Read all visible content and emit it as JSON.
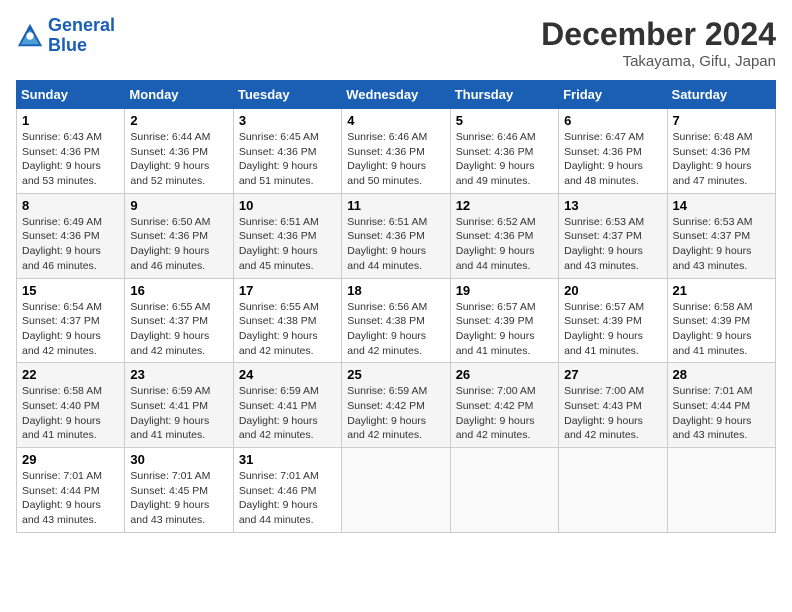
{
  "logo": {
    "line1": "General",
    "line2": "Blue"
  },
  "header": {
    "month": "December 2024",
    "location": "Takayama, Gifu, Japan"
  },
  "weekdays": [
    "Sunday",
    "Monday",
    "Tuesday",
    "Wednesday",
    "Thursday",
    "Friday",
    "Saturday"
  ],
  "weeks": [
    [
      {
        "day": "1",
        "sunrise": "6:43 AM",
        "sunset": "4:36 PM",
        "daylight": "9 hours and 53 minutes."
      },
      {
        "day": "2",
        "sunrise": "6:44 AM",
        "sunset": "4:36 PM",
        "daylight": "9 hours and 52 minutes."
      },
      {
        "day": "3",
        "sunrise": "6:45 AM",
        "sunset": "4:36 PM",
        "daylight": "9 hours and 51 minutes."
      },
      {
        "day": "4",
        "sunrise": "6:46 AM",
        "sunset": "4:36 PM",
        "daylight": "9 hours and 50 minutes."
      },
      {
        "day": "5",
        "sunrise": "6:46 AM",
        "sunset": "4:36 PM",
        "daylight": "9 hours and 49 minutes."
      },
      {
        "day": "6",
        "sunrise": "6:47 AM",
        "sunset": "4:36 PM",
        "daylight": "9 hours and 48 minutes."
      },
      {
        "day": "7",
        "sunrise": "6:48 AM",
        "sunset": "4:36 PM",
        "daylight": "9 hours and 47 minutes."
      }
    ],
    [
      {
        "day": "8",
        "sunrise": "6:49 AM",
        "sunset": "4:36 PM",
        "daylight": "9 hours and 46 minutes."
      },
      {
        "day": "9",
        "sunrise": "6:50 AM",
        "sunset": "4:36 PM",
        "daylight": "9 hours and 46 minutes."
      },
      {
        "day": "10",
        "sunrise": "6:51 AM",
        "sunset": "4:36 PM",
        "daylight": "9 hours and 45 minutes."
      },
      {
        "day": "11",
        "sunrise": "6:51 AM",
        "sunset": "4:36 PM",
        "daylight": "9 hours and 44 minutes."
      },
      {
        "day": "12",
        "sunrise": "6:52 AM",
        "sunset": "4:36 PM",
        "daylight": "9 hours and 44 minutes."
      },
      {
        "day": "13",
        "sunrise": "6:53 AM",
        "sunset": "4:37 PM",
        "daylight": "9 hours and 43 minutes."
      },
      {
        "day": "14",
        "sunrise": "6:53 AM",
        "sunset": "4:37 PM",
        "daylight": "9 hours and 43 minutes."
      }
    ],
    [
      {
        "day": "15",
        "sunrise": "6:54 AM",
        "sunset": "4:37 PM",
        "daylight": "9 hours and 42 minutes."
      },
      {
        "day": "16",
        "sunrise": "6:55 AM",
        "sunset": "4:37 PM",
        "daylight": "9 hours and 42 minutes."
      },
      {
        "day": "17",
        "sunrise": "6:55 AM",
        "sunset": "4:38 PM",
        "daylight": "9 hours and 42 minutes."
      },
      {
        "day": "18",
        "sunrise": "6:56 AM",
        "sunset": "4:38 PM",
        "daylight": "9 hours and 42 minutes."
      },
      {
        "day": "19",
        "sunrise": "6:57 AM",
        "sunset": "4:39 PM",
        "daylight": "9 hours and 41 minutes."
      },
      {
        "day": "20",
        "sunrise": "6:57 AM",
        "sunset": "4:39 PM",
        "daylight": "9 hours and 41 minutes."
      },
      {
        "day": "21",
        "sunrise": "6:58 AM",
        "sunset": "4:39 PM",
        "daylight": "9 hours and 41 minutes."
      }
    ],
    [
      {
        "day": "22",
        "sunrise": "6:58 AM",
        "sunset": "4:40 PM",
        "daylight": "9 hours and 41 minutes."
      },
      {
        "day": "23",
        "sunrise": "6:59 AM",
        "sunset": "4:41 PM",
        "daylight": "9 hours and 41 minutes."
      },
      {
        "day": "24",
        "sunrise": "6:59 AM",
        "sunset": "4:41 PM",
        "daylight": "9 hours and 42 minutes."
      },
      {
        "day": "25",
        "sunrise": "6:59 AM",
        "sunset": "4:42 PM",
        "daylight": "9 hours and 42 minutes."
      },
      {
        "day": "26",
        "sunrise": "7:00 AM",
        "sunset": "4:42 PM",
        "daylight": "9 hours and 42 minutes."
      },
      {
        "day": "27",
        "sunrise": "7:00 AM",
        "sunset": "4:43 PM",
        "daylight": "9 hours and 42 minutes."
      },
      {
        "day": "28",
        "sunrise": "7:01 AM",
        "sunset": "4:44 PM",
        "daylight": "9 hours and 43 minutes."
      }
    ],
    [
      {
        "day": "29",
        "sunrise": "7:01 AM",
        "sunset": "4:44 PM",
        "daylight": "9 hours and 43 minutes."
      },
      {
        "day": "30",
        "sunrise": "7:01 AM",
        "sunset": "4:45 PM",
        "daylight": "9 hours and 43 minutes."
      },
      {
        "day": "31",
        "sunrise": "7:01 AM",
        "sunset": "4:46 PM",
        "daylight": "9 hours and 44 minutes."
      },
      null,
      null,
      null,
      null
    ]
  ]
}
